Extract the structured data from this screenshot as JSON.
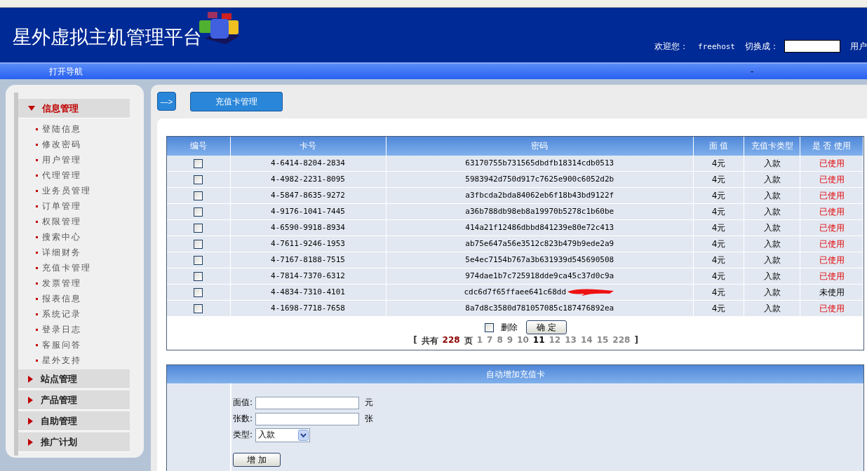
{
  "header": {
    "title": "星外虚拟主机管理平台",
    "welcome_label": "欢迎您：",
    "username": "freehost",
    "switch_label": "切换成：",
    "switch_suffix": "用户"
  },
  "nav_bar": {
    "toggle": "打开导航",
    "marker": "-"
  },
  "sidebar": {
    "groups": [
      {
        "label": "信息管理",
        "expanded": true,
        "children": [
          {
            "label": "登陆信息"
          },
          {
            "label": "修改密码"
          },
          {
            "label": "用户管理"
          },
          {
            "label": "代理管理"
          },
          {
            "label": "业务员管理"
          },
          {
            "label": "订单管理"
          },
          {
            "label": "权限管理"
          },
          {
            "label": "搜索中心"
          },
          {
            "label": "详细财务"
          },
          {
            "label": "充值卡管理"
          },
          {
            "label": "发票管理"
          },
          {
            "label": "报表信息"
          },
          {
            "label": "系统记录"
          },
          {
            "label": "登录日志"
          },
          {
            "label": "客服问答"
          },
          {
            "label": "星外支持"
          }
        ]
      },
      {
        "label": "站点管理",
        "expanded": false
      },
      {
        "label": "产品管理",
        "expanded": false
      },
      {
        "label": "自助管理",
        "expanded": false
      },
      {
        "label": "推广计划",
        "expanded": false
      }
    ]
  },
  "toolbar": {
    "arrow": "—>",
    "tab": "充值卡管理"
  },
  "table": {
    "columns": [
      "编号",
      "卡号",
      "密码",
      "面 值",
      "充值卡类型",
      "是 否 使用"
    ],
    "rows": [
      {
        "checked": false,
        "card": "4-6414-8204-2834",
        "password": "63170755b731565dbdfb18314cdb0513",
        "value": "4元",
        "type": "入款",
        "status": "已使用",
        "used": true,
        "redacted": false
      },
      {
        "checked": false,
        "card": "4-4982-2231-8095",
        "password": "5983942d750d917c7625e900c6052d2b",
        "value": "4元",
        "type": "入款",
        "status": "已使用",
        "used": true,
        "redacted": false
      },
      {
        "checked": false,
        "card": "4-5847-8635-9272",
        "password": "a3fbcda2bda84062eb6f18b43bd9122f",
        "value": "4元",
        "type": "入款",
        "status": "已使用",
        "used": true,
        "redacted": false
      },
      {
        "checked": false,
        "card": "4-9176-1041-7445",
        "password": "a36b788db98eb8a19970b5278c1b60be",
        "value": "4元",
        "type": "入款",
        "status": "已使用",
        "used": true,
        "redacted": false
      },
      {
        "checked": false,
        "card": "4-6590-9918-8934",
        "password": "414a21f12486dbbd841239e80e72c413",
        "value": "4元",
        "type": "入款",
        "status": "已使用",
        "used": true,
        "redacted": false
      },
      {
        "checked": false,
        "card": "4-7611-9246-1953",
        "password": "ab75e647a56e3512c823b479b9ede2a9",
        "value": "4元",
        "type": "入款",
        "status": "已使用",
        "used": true,
        "redacted": false
      },
      {
        "checked": false,
        "card": "4-7167-8188-7515",
        "password": "5e4ec7154b767a3b631939d545690508",
        "value": "4元",
        "type": "入款",
        "status": "已使用",
        "used": true,
        "redacted": false
      },
      {
        "checked": false,
        "card": "4-7814-7370-6312",
        "password": "974dae1b7c725918dde9ca45c37d0c9a",
        "value": "4元",
        "type": "入款",
        "status": "已使用",
        "used": true,
        "redacted": false
      },
      {
        "checked": false,
        "card": "4-4834-7310-4101",
        "password": "cdc6d7f65ffaee641c68dd",
        "value": "4元",
        "type": "入款",
        "status": "未使用",
        "used": false,
        "redacted": true
      },
      {
        "checked": false,
        "card": "4-1698-7718-7658",
        "password": "8a7d8c3580d781057085c187476892ea",
        "value": "4元",
        "type": "入款",
        "status": "已使用",
        "used": true,
        "redacted": false
      }
    ],
    "delete_checked": false,
    "delete_label": "删除",
    "confirm": "确 定",
    "pager": {
      "open": "[",
      "total_label": "共有",
      "total": "228",
      "unit": "页",
      "pages": [
        {
          "label": "1",
          "selected": false
        },
        {
          "label": "7",
          "selected": false
        },
        {
          "label": "8",
          "selected": false
        },
        {
          "label": "9",
          "selected": false
        },
        {
          "label": "10",
          "selected": false
        },
        {
          "label": "11",
          "selected": true
        },
        {
          "label": "12",
          "selected": false
        },
        {
          "label": "13",
          "selected": false
        },
        {
          "label": "14",
          "selected": false
        },
        {
          "label": "15",
          "selected": false
        },
        {
          "label": "228",
          "selected": false
        }
      ],
      "close": "]"
    }
  },
  "add_form": {
    "title": "自动增加充值卡",
    "fields": [
      {
        "label": "面值:",
        "kind": "text",
        "unit": "元"
      },
      {
        "label": "张数:",
        "kind": "text",
        "unit": "张"
      },
      {
        "label": "类型:",
        "kind": "select",
        "value": "入款"
      }
    ],
    "button": "增 加"
  }
}
